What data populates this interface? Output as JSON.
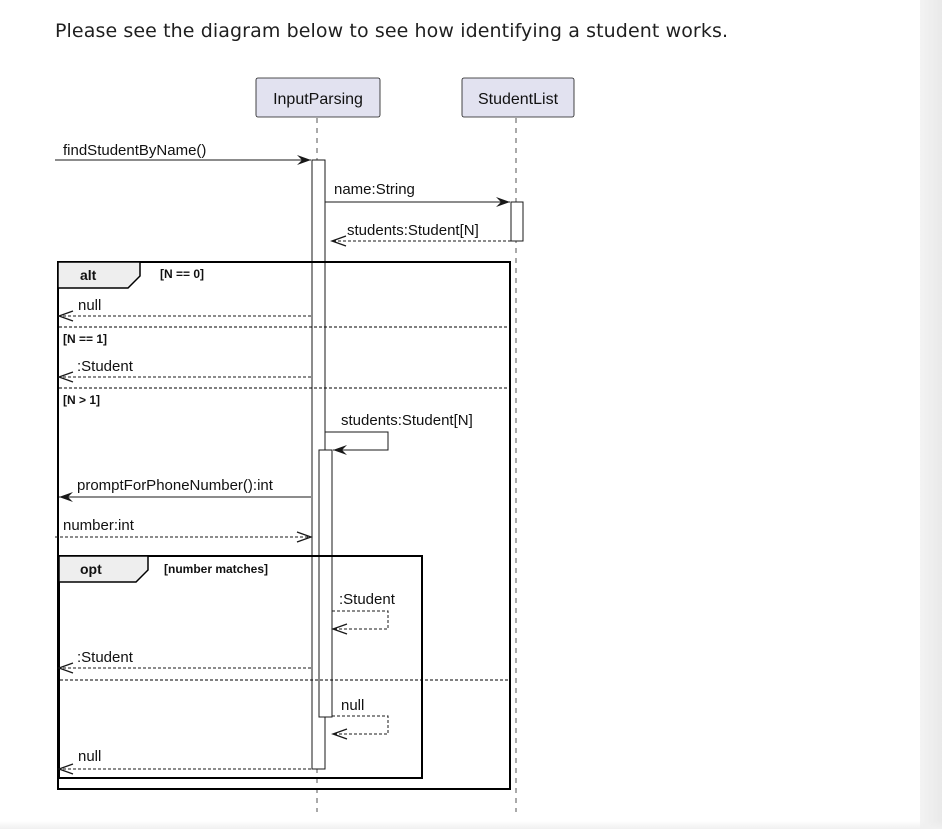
{
  "intro_text": "Please see the diagram below to see how identifying a student works.",
  "participants": [
    {
      "id": "p1",
      "name": "InputParsing"
    },
    {
      "id": "p2",
      "name": "StudentList"
    }
  ],
  "messages": {
    "find_student": "findStudentByName()",
    "name_string": "name:String",
    "students_return": "students:Student[N]",
    "null_return_1": "null",
    "student_return_1": ":Student",
    "self_students": "students:Student[N]",
    "prompt_phone": "promptForPhoneNumber():int",
    "number_int": "number:int",
    "self_student": ":Student",
    "student_return_2": ":Student",
    "self_null": "null",
    "null_return_2": "null"
  },
  "fragments": {
    "alt": {
      "keyword": "alt",
      "guards": [
        "[N == 0]",
        "[N == 1]",
        "[N > 1]"
      ]
    },
    "opt": {
      "keyword": "opt",
      "guard": "[number matches]"
    }
  },
  "colors": {
    "participant_fill": "#e2e2f0",
    "participant_border": "#181818",
    "line": "#181818",
    "lifeline": "#555555",
    "frame": "#000000",
    "text": "#111111"
  }
}
